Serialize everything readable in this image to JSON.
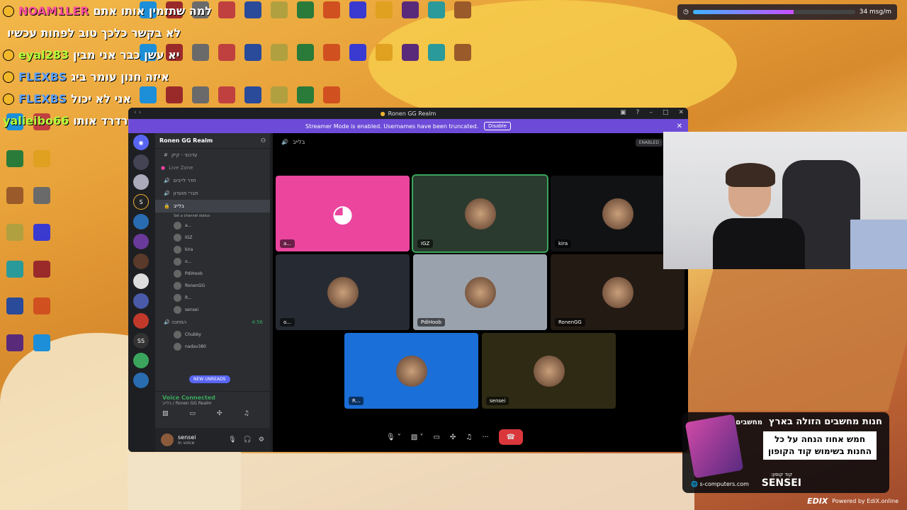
{
  "chat": [
    {
      "user": "NOAM1LER",
      "msg": "למה שתזמין אותו אתם",
      "color": "pink"
    },
    {
      "user": "",
      "msg": "לא בקשר כלכך טוב לפחות עכשיו",
      "color": "green"
    },
    {
      "user": "eyal283",
      "msg": "יא עשן כבר אני מבין",
      "color": "green"
    },
    {
      "user": "FLEXBS",
      "msg": "איזה חנון עומר ביג",
      "color": "blue"
    },
    {
      "user": "FLEXBS",
      "msg": "אני לא יכול",
      "color": "blue"
    },
    {
      "user": "yalieibo66",
      "msg": "תרדרד אותו",
      "color": "green"
    }
  ],
  "topbar": {
    "progress": 0.62,
    "label": "34 msg/m"
  },
  "window": {
    "title": "Ronen GG Realm",
    "banner_text": "Streamer Mode is enabled. Usernames have been truncated.",
    "banner_button": "Disable",
    "guild_name": "Ronen GG Realm",
    "channels": [
      {
        "name": "עדכוני - קיק",
        "type": "text",
        "active": false
      },
      {
        "name": "Live Zone",
        "type": "category",
        "active": false
      },
      {
        "name": "חדר לייבים",
        "type": "voice",
        "active": false
      },
      {
        "name": "חברי מועדון",
        "type": "voice",
        "active": false
      },
      {
        "name": "בלייב",
        "type": "voice",
        "active": true
      },
      {
        "name": "Set a channel status",
        "type": "status",
        "active": false
      }
    ],
    "voice_members": [
      "a...",
      "IGZ",
      "kira",
      "o...",
      "PdiHoob",
      "RonenGG",
      "R...",
      "sensei"
    ],
    "channels2": [
      {
        "name": "המתנה",
        "time": "4:56"
      }
    ],
    "voice_members2": [
      "Chubby",
      "nadav380"
    ],
    "new_unreads": "NEW UNREADS",
    "voice_connected": "Voice Connected",
    "voice_channel": "בלייב / Ronen GG Realm",
    "user_name": "sensei",
    "user_status": "In voice",
    "stage_channel": "בלייב",
    "enabled_label": "ENABLED",
    "tiles": [
      {
        "name": "a...",
        "bg": "#eb459e",
        "icon": "discord-logo-icon",
        "speaking": false
      },
      {
        "name": "IGZ",
        "bg": "#2b3a2e",
        "icon": "avatar",
        "speaking": true
      },
      {
        "name": "kira",
        "bg": "#111214",
        "icon": "avatar",
        "speaking": false
      },
      {
        "name": "o...",
        "bg": "#262a33",
        "icon": "avatar",
        "speaking": false
      },
      {
        "name": "PdiHoob",
        "bg": "#9aa3ad",
        "icon": "avatar",
        "speaking": false
      },
      {
        "name": "RonenGG",
        "bg": "#231a14",
        "icon": "avatar",
        "speaking": false
      },
      {
        "name": "R...",
        "bg": "#1b6fd8",
        "icon": "avatar",
        "speaking": false
      },
      {
        "name": "sensei",
        "bg": "#2e2a14",
        "icon": "avatar",
        "speaking": false
      }
    ]
  },
  "ad": {
    "title": "חנות מחשבים הזולה בארץ",
    "brand": "מחשבים",
    "line1": "חמש אחוז הנחה על כל",
    "line2": "החנות בשימוש קוד הקופון",
    "code_label": "קוד קופון:",
    "code": "SENSEI",
    "site": "s-computers.com"
  },
  "watermark": {
    "logo": "EDIX",
    "text": "Powered by EdiX.online"
  }
}
